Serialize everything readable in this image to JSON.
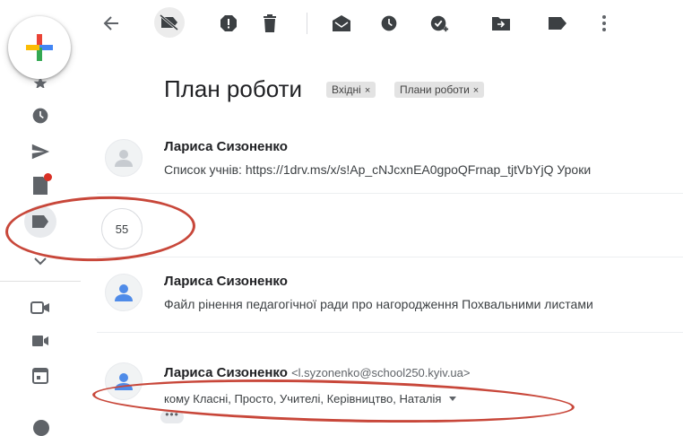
{
  "toolbar": {
    "icons": [
      "back-arrow-icon",
      "label-off-icon",
      "report-spam-icon",
      "delete-icon",
      "mark-unread-icon",
      "snooze-icon",
      "add-task-icon",
      "move-to-icon",
      "label-icon",
      "more-vert-icon"
    ]
  },
  "thread": {
    "subject": "План роботи",
    "labels": [
      {
        "text": "Вхідні",
        "remove": "×"
      },
      {
        "text": "Плани роботи",
        "remove": "×"
      }
    ]
  },
  "messages": [
    {
      "sender": "Лариса Сизоненко",
      "snippet": "Список учнів: https://1drv.ms/x/s!Ap_cNJcxnEA0gpoQFrnap_tjtVbYjQ Уроки"
    },
    {
      "collapsed_count": "55"
    },
    {
      "sender": "Лариса Сизоненко",
      "snippet": "Файл рінення педагогічної ради про нагородження Похвальними листами"
    },
    {
      "sender": "Лариса Сизоненко",
      "email": "<l.syzonenko@school250.kyiv.ua>",
      "recipients": "кому Класні, Просто, Учителі, Керівництво, Наталія",
      "more": "•••"
    }
  ],
  "colors": {
    "accent_ring": "#c8473a",
    "badge": "#d93025"
  }
}
